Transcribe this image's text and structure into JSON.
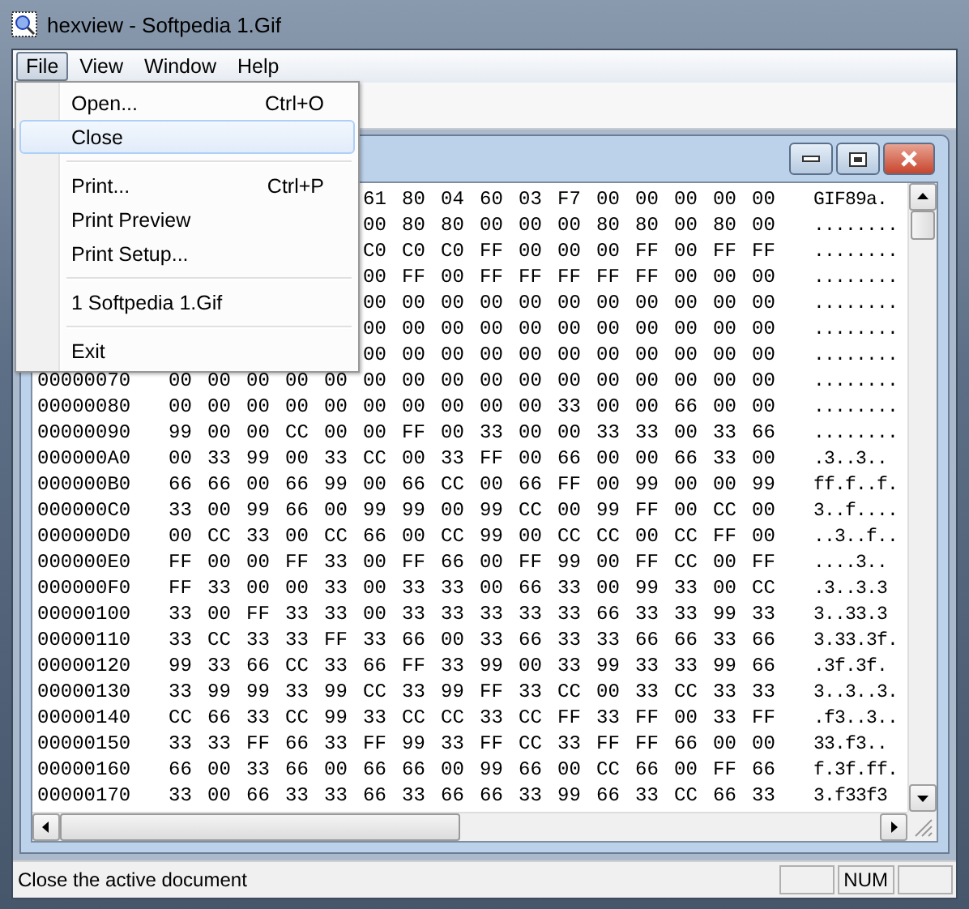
{
  "window": {
    "title": "hexview - Softpedia 1.Gif"
  },
  "menu_bar": [
    {
      "label": "File",
      "selected": true
    },
    {
      "label": "View",
      "selected": false
    },
    {
      "label": "Window",
      "selected": false
    },
    {
      "label": "Help",
      "selected": false
    }
  ],
  "open_menu": {
    "items": [
      {
        "kind": "item",
        "label": "Open...",
        "shortcut": "Ctrl+O",
        "selected": false
      },
      {
        "kind": "item",
        "label": "Close",
        "selected": true
      },
      {
        "kind": "separator"
      },
      {
        "kind": "item",
        "label": "Print...",
        "shortcut": "Ctrl+P",
        "selected": false
      },
      {
        "kind": "item",
        "label": "Print Preview",
        "selected": false
      },
      {
        "kind": "item",
        "label": "Print Setup...",
        "selected": false
      },
      {
        "kind": "separator"
      },
      {
        "kind": "item",
        "label": "1 Softpedia 1.Gif",
        "selected": false
      },
      {
        "kind": "separator"
      },
      {
        "kind": "item",
        "label": "Exit",
        "selected": false
      }
    ]
  },
  "document": {
    "rows": [
      {
        "bytes": [
          "61",
          "80",
          "04",
          "60",
          "03",
          "F7",
          "00",
          "00",
          "00",
          "00",
          "00"
        ],
        "ascii": "GIF89a."
      },
      {
        "bytes": [
          "00",
          "80",
          "80",
          "00",
          "00",
          "00",
          "80",
          "80",
          "00",
          "80",
          "00"
        ],
        "ascii": "........"
      },
      {
        "bytes": [
          "C0",
          "C0",
          "C0",
          "FF",
          "00",
          "00",
          "00",
          "FF",
          "00",
          "FF",
          "FF"
        ],
        "ascii": "........"
      },
      {
        "bytes": [
          "00",
          "FF",
          "00",
          "FF",
          "FF",
          "FF",
          "FF",
          "FF",
          "00",
          "00",
          "00"
        ],
        "ascii": "........"
      },
      {
        "bytes": [
          "00",
          "00",
          "00",
          "00",
          "00",
          "00",
          "00",
          "00",
          "00",
          "00",
          "00"
        ],
        "ascii": "........"
      },
      {
        "bytes": [
          "00",
          "00",
          "00",
          "00",
          "00",
          "00",
          "00",
          "00",
          "00",
          "00",
          "00"
        ],
        "ascii": "........"
      },
      {
        "bytes": [
          "00",
          "00",
          "00",
          "00",
          "00",
          "00",
          "00",
          "00",
          "00",
          "00",
          "00"
        ],
        "ascii": "........"
      },
      {
        "address": "00000070",
        "bytes": [
          "00",
          "00",
          "00",
          "00",
          "00",
          "00",
          "00",
          "00",
          "00",
          "00",
          "00",
          "00",
          "00",
          "00",
          "00",
          "00"
        ],
        "ascii": "........"
      },
      {
        "address": "00000080",
        "bytes": [
          "00",
          "00",
          "00",
          "00",
          "00",
          "00",
          "00",
          "00",
          "00",
          "00",
          "33",
          "00",
          "00",
          "66",
          "00",
          "00"
        ],
        "ascii": "........"
      },
      {
        "address": "00000090",
        "bytes": [
          "99",
          "00",
          "00",
          "CC",
          "00",
          "00",
          "FF",
          "00",
          "33",
          "00",
          "00",
          "33",
          "33",
          "00",
          "33",
          "66"
        ],
        "ascii": "........"
      },
      {
        "address": "000000A0",
        "bytes": [
          "00",
          "33",
          "99",
          "00",
          "33",
          "CC",
          "00",
          "33",
          "FF",
          "00",
          "66",
          "00",
          "00",
          "66",
          "33",
          "00"
        ],
        "ascii": ".3..3.."
      },
      {
        "address": "000000B0",
        "bytes": [
          "66",
          "66",
          "00",
          "66",
          "99",
          "00",
          "66",
          "CC",
          "00",
          "66",
          "FF",
          "00",
          "99",
          "00",
          "00",
          "99"
        ],
        "ascii": "ff.f..f."
      },
      {
        "address": "000000C0",
        "bytes": [
          "33",
          "00",
          "99",
          "66",
          "00",
          "99",
          "99",
          "00",
          "99",
          "CC",
          "00",
          "99",
          "FF",
          "00",
          "CC",
          "00"
        ],
        "ascii": "3..f...."
      },
      {
        "address": "000000D0",
        "bytes": [
          "00",
          "CC",
          "33",
          "00",
          "CC",
          "66",
          "00",
          "CC",
          "99",
          "00",
          "CC",
          "CC",
          "00",
          "CC",
          "FF",
          "00"
        ],
        "ascii": "..3..f.."
      },
      {
        "address": "000000E0",
        "bytes": [
          "FF",
          "00",
          "00",
          "FF",
          "33",
          "00",
          "FF",
          "66",
          "00",
          "FF",
          "99",
          "00",
          "FF",
          "CC",
          "00",
          "FF"
        ],
        "ascii": "....3.."
      },
      {
        "address": "000000F0",
        "bytes": [
          "FF",
          "33",
          "00",
          "00",
          "33",
          "00",
          "33",
          "33",
          "00",
          "66",
          "33",
          "00",
          "99",
          "33",
          "00",
          "CC"
        ],
        "ascii": ".3..3.3"
      },
      {
        "address": "00000100",
        "bytes": [
          "33",
          "00",
          "FF",
          "33",
          "33",
          "00",
          "33",
          "33",
          "33",
          "33",
          "33",
          "66",
          "33",
          "33",
          "99",
          "33"
        ],
        "ascii": "3..33.3"
      },
      {
        "address": "00000110",
        "bytes": [
          "33",
          "CC",
          "33",
          "33",
          "FF",
          "33",
          "66",
          "00",
          "33",
          "66",
          "33",
          "33",
          "66",
          "66",
          "33",
          "66"
        ],
        "ascii": "3.33.3f."
      },
      {
        "address": "00000120",
        "bytes": [
          "99",
          "33",
          "66",
          "CC",
          "33",
          "66",
          "FF",
          "33",
          "99",
          "00",
          "33",
          "99",
          "33",
          "33",
          "99",
          "66"
        ],
        "ascii": ".3f.3f."
      },
      {
        "address": "00000130",
        "bytes": [
          "33",
          "99",
          "99",
          "33",
          "99",
          "CC",
          "33",
          "99",
          "FF",
          "33",
          "CC",
          "00",
          "33",
          "CC",
          "33",
          "33"
        ],
        "ascii": "3..3..3."
      },
      {
        "address": "00000140",
        "bytes": [
          "CC",
          "66",
          "33",
          "CC",
          "99",
          "33",
          "CC",
          "CC",
          "33",
          "CC",
          "FF",
          "33",
          "FF",
          "00",
          "33",
          "FF"
        ],
        "ascii": ".f3..3.."
      },
      {
        "address": "00000150",
        "bytes": [
          "33",
          "33",
          "FF",
          "66",
          "33",
          "FF",
          "99",
          "33",
          "FF",
          "CC",
          "33",
          "FF",
          "FF",
          "66",
          "00",
          "00"
        ],
        "ascii": "33.f3.."
      },
      {
        "address": "00000160",
        "bytes": [
          "66",
          "00",
          "33",
          "66",
          "00",
          "66",
          "66",
          "00",
          "99",
          "66",
          "00",
          "CC",
          "66",
          "00",
          "FF",
          "66"
        ],
        "ascii": "f.3f.ff."
      },
      {
        "address": "00000170",
        "bytes": [
          "33",
          "00",
          "66",
          "33",
          "33",
          "66",
          "33",
          "66",
          "66",
          "33",
          "99",
          "66",
          "33",
          "CC",
          "66",
          "33"
        ],
        "ascii": "3.f33f3"
      }
    ]
  },
  "status_bar": {
    "message": "Close the active document",
    "indicators": [
      "NUM"
    ]
  }
}
